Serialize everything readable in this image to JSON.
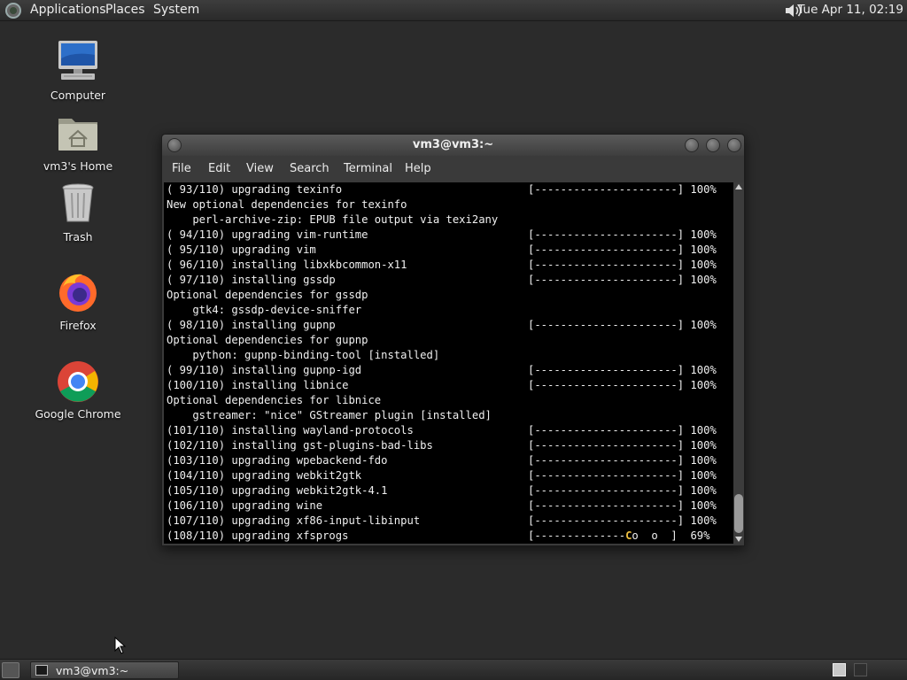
{
  "top_panel": {
    "menus": [
      "Applications",
      "Places",
      "System"
    ],
    "clock": "Tue Apr 11, 02:19"
  },
  "desktop": {
    "icons": [
      {
        "label": "Computer",
        "icon": "computer-icon"
      },
      {
        "label": "vm3's Home",
        "icon": "home-folder-icon"
      },
      {
        "label": "Trash",
        "icon": "trash-icon"
      },
      {
        "label": "Firefox",
        "icon": "firefox-icon"
      },
      {
        "label": "Google Chrome",
        "icon": "chrome-icon"
      }
    ]
  },
  "terminal": {
    "title": "vm3@vm3:~",
    "menus": [
      "File",
      "Edit",
      "View",
      "Search",
      "Terminal",
      "Help"
    ],
    "lines": [
      {
        "text": "( 93/110) upgrading texinfo",
        "bar": "[----------------------] 100%"
      },
      {
        "text": "New optional dependencies for texinfo",
        "bar": ""
      },
      {
        "text": "    perl-archive-zip: EPUB file output via texi2any",
        "bar": ""
      },
      {
        "text": "( 94/110) upgrading vim-runtime",
        "bar": "[----------------------] 100%"
      },
      {
        "text": "( 95/110) upgrading vim",
        "bar": "[----------------------] 100%"
      },
      {
        "text": "( 96/110) installing libxkbcommon-x11",
        "bar": "[----------------------] 100%"
      },
      {
        "text": "( 97/110) installing gssdp",
        "bar": "[----------------------] 100%"
      },
      {
        "text": "Optional dependencies for gssdp",
        "bar": ""
      },
      {
        "text": "    gtk4: gssdp-device-sniffer",
        "bar": ""
      },
      {
        "text": "( 98/110) installing gupnp",
        "bar": "[----------------------] 100%"
      },
      {
        "text": "Optional dependencies for gupnp",
        "bar": ""
      },
      {
        "text": "    python: gupnp-binding-tool [installed]",
        "bar": ""
      },
      {
        "text": "( 99/110) installing gupnp-igd",
        "bar": "[----------------------] 100%"
      },
      {
        "text": "(100/110) installing libnice",
        "bar": "[----------------------] 100%"
      },
      {
        "text": "Optional dependencies for libnice",
        "bar": ""
      },
      {
        "text": "    gstreamer: \"nice\" GStreamer plugin [installed]",
        "bar": ""
      },
      {
        "text": "(101/110) installing wayland-protocols",
        "bar": "[----------------------] 100%"
      },
      {
        "text": "(102/110) installing gst-plugins-bad-libs",
        "bar": "[----------------------] 100%"
      },
      {
        "text": "(103/110) upgrading wpebackend-fdo",
        "bar": "[----------------------] 100%"
      },
      {
        "text": "(104/110) upgrading webkit2gtk",
        "bar": "[----------------------] 100%"
      },
      {
        "text": "(105/110) upgrading webkit2gtk-4.1",
        "bar": "[----------------------] 100%"
      },
      {
        "text": "(106/110) upgrading wine",
        "bar": "[----------------------] 100%"
      },
      {
        "text": "(107/110) upgrading xf86-input-libinput",
        "bar": "[----------------------] 100%"
      },
      {
        "text": "(108/110) upgrading xfsprogs",
        "bar_progress": "[--------------",
        "bar_pacman": "C",
        "bar_rest": "o  o  ]  69%"
      }
    ]
  },
  "taskbar": {
    "task_label": "vm3@vm3:~"
  }
}
